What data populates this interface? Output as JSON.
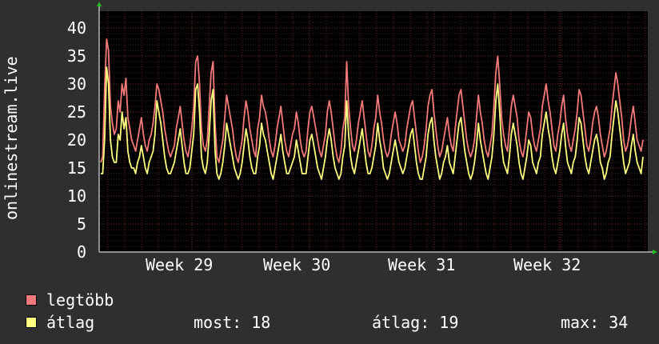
{
  "chart_data": {
    "type": "line",
    "ylabel": "onlinestream.live",
    "ylim": [
      0,
      43
    ],
    "yticks": [
      0,
      5,
      10,
      15,
      20,
      25,
      30,
      35,
      40
    ],
    "x_ticks": [
      "Week 29",
      "Week 30",
      "Week 31",
      "Week 32"
    ],
    "grid": true,
    "series": [
      {
        "name": "legtöbb",
        "color": "#f47a7a",
        "values": [
          16,
          17,
          29,
          38,
          36,
          26,
          23,
          21,
          22,
          27,
          25,
          30,
          28,
          31,
          24,
          22,
          20,
          19,
          18,
          20,
          22,
          24,
          21,
          19,
          18,
          20,
          21,
          23,
          26,
          30,
          29,
          27,
          25,
          22,
          20,
          18,
          17,
          18,
          19,
          22,
          24,
          26,
          23,
          20,
          18,
          17,
          19,
          22,
          26,
          34,
          35,
          30,
          22,
          19,
          18,
          20,
          26,
          32,
          34,
          23,
          17,
          16,
          18,
          20,
          24,
          28,
          26,
          24,
          22,
          19,
          17,
          16,
          18,
          20,
          24,
          27,
          25,
          22,
          20,
          18,
          17,
          22,
          24,
          28,
          26,
          25,
          23,
          20,
          18,
          17,
          19,
          22,
          24,
          26,
          23,
          20,
          18,
          17,
          19,
          21,
          22,
          25,
          23,
          20,
          18,
          17,
          18,
          22,
          25,
          26,
          24,
          22,
          20,
          18,
          17,
          19,
          21,
          25,
          27,
          25,
          22,
          19,
          17,
          16,
          18,
          22,
          24,
          34,
          26,
          22,
          19,
          18,
          20,
          23,
          25,
          27,
          24,
          21,
          18,
          17,
          19,
          22,
          24,
          28,
          25,
          23,
          20,
          18,
          17,
          18,
          21,
          23,
          25,
          23,
          20,
          19,
          18,
          19,
          22,
          24,
          26,
          27,
          24,
          21,
          18,
          16,
          17,
          19,
          22,
          26,
          28,
          29,
          25,
          22,
          19,
          17,
          18,
          20,
          22,
          24,
          21,
          19,
          18,
          22,
          25,
          28,
          29,
          26,
          23,
          20,
          18,
          17,
          18,
          20,
          24,
          28,
          25,
          23,
          20,
          18,
          17,
          19,
          21,
          26,
          32,
          35,
          30,
          24,
          21,
          19,
          18,
          22,
          26,
          28,
          26,
          24,
          20,
          18,
          17,
          19,
          22,
          25,
          24,
          21,
          19,
          18,
          20,
          22,
          26,
          28,
          30,
          27,
          25,
          22,
          19,
          18,
          21,
          23,
          26,
          28,
          24,
          21,
          19,
          18,
          20,
          22,
          25,
          29,
          28,
          25,
          22,
          19,
          18,
          20,
          23,
          25,
          26,
          24,
          21,
          19,
          17,
          18,
          20,
          22,
          26,
          29,
          32,
          30,
          27,
          24,
          20,
          18,
          19,
          21,
          24,
          26,
          23,
          20,
          19,
          18,
          20
        ]
      },
      {
        "name": "átlag",
        "color": "#ffff80",
        "values": [
          14,
          14,
          20,
          33,
          30,
          20,
          17,
          16,
          16,
          21,
          20,
          25,
          22,
          24,
          18,
          16,
          15,
          15,
          14,
          16,
          17,
          19,
          17,
          15,
          14,
          16,
          17,
          18,
          21,
          27,
          25,
          23,
          20,
          17,
          15,
          14,
          14,
          15,
          16,
          18,
          20,
          22,
          19,
          16,
          14,
          14,
          15,
          18,
          21,
          29,
          30,
          25,
          17,
          15,
          14,
          16,
          21,
          27,
          29,
          18,
          14,
          13,
          14,
          16,
          19,
          23,
          21,
          19,
          17,
          15,
          14,
          13,
          14,
          16,
          19,
          22,
          20,
          17,
          15,
          14,
          14,
          17,
          19,
          23,
          21,
          20,
          18,
          16,
          14,
          13,
          15,
          17,
          19,
          21,
          18,
          16,
          14,
          14,
          15,
          16,
          17,
          20,
          18,
          16,
          14,
          14,
          14,
          17,
          20,
          21,
          19,
          17,
          15,
          14,
          13,
          15,
          17,
          20,
          22,
          20,
          17,
          15,
          14,
          13,
          14,
          17,
          19,
          27,
          21,
          17,
          15,
          14,
          16,
          18,
          20,
          22,
          19,
          16,
          14,
          14,
          15,
          17,
          19,
          23,
          20,
          18,
          15,
          14,
          13,
          14,
          16,
          18,
          20,
          18,
          16,
          15,
          14,
          15,
          17,
          19,
          21,
          22,
          19,
          16,
          14,
          13,
          13,
          15,
          17,
          21,
          23,
          24,
          20,
          17,
          15,
          13,
          14,
          16,
          17,
          19,
          16,
          15,
          14,
          17,
          20,
          23,
          24,
          21,
          18,
          16,
          14,
          13,
          14,
          16,
          19,
          23,
          20,
          18,
          16,
          14,
          13,
          15,
          17,
          21,
          27,
          30,
          25,
          19,
          16,
          15,
          14,
          17,
          21,
          23,
          21,
          19,
          16,
          14,
          13,
          15,
          17,
          20,
          19,
          16,
          15,
          14,
          16,
          17,
          21,
          23,
          25,
          22,
          20,
          17,
          15,
          14,
          16,
          18,
          21,
          23,
          19,
          16,
          15,
          14,
          16,
          17,
          20,
          24,
          23,
          20,
          17,
          15,
          14,
          16,
          18,
          20,
          21,
          19,
          16,
          15,
          13,
          14,
          16,
          17,
          21,
          24,
          27,
          25,
          22,
          19,
          16,
          14,
          15,
          16,
          19,
          21,
          18,
          16,
          15,
          14,
          17
        ]
      }
    ]
  },
  "legend": [
    {
      "label": "legtöbb",
      "color": "#f47a7a"
    },
    {
      "label": "átlag",
      "color": "#ffff80"
    }
  ],
  "stats": {
    "most_label": "most:",
    "most_value": "18",
    "atlag_label": "átlag:",
    "atlag_value": "19",
    "max_label": "max:",
    "max_value": "34"
  }
}
